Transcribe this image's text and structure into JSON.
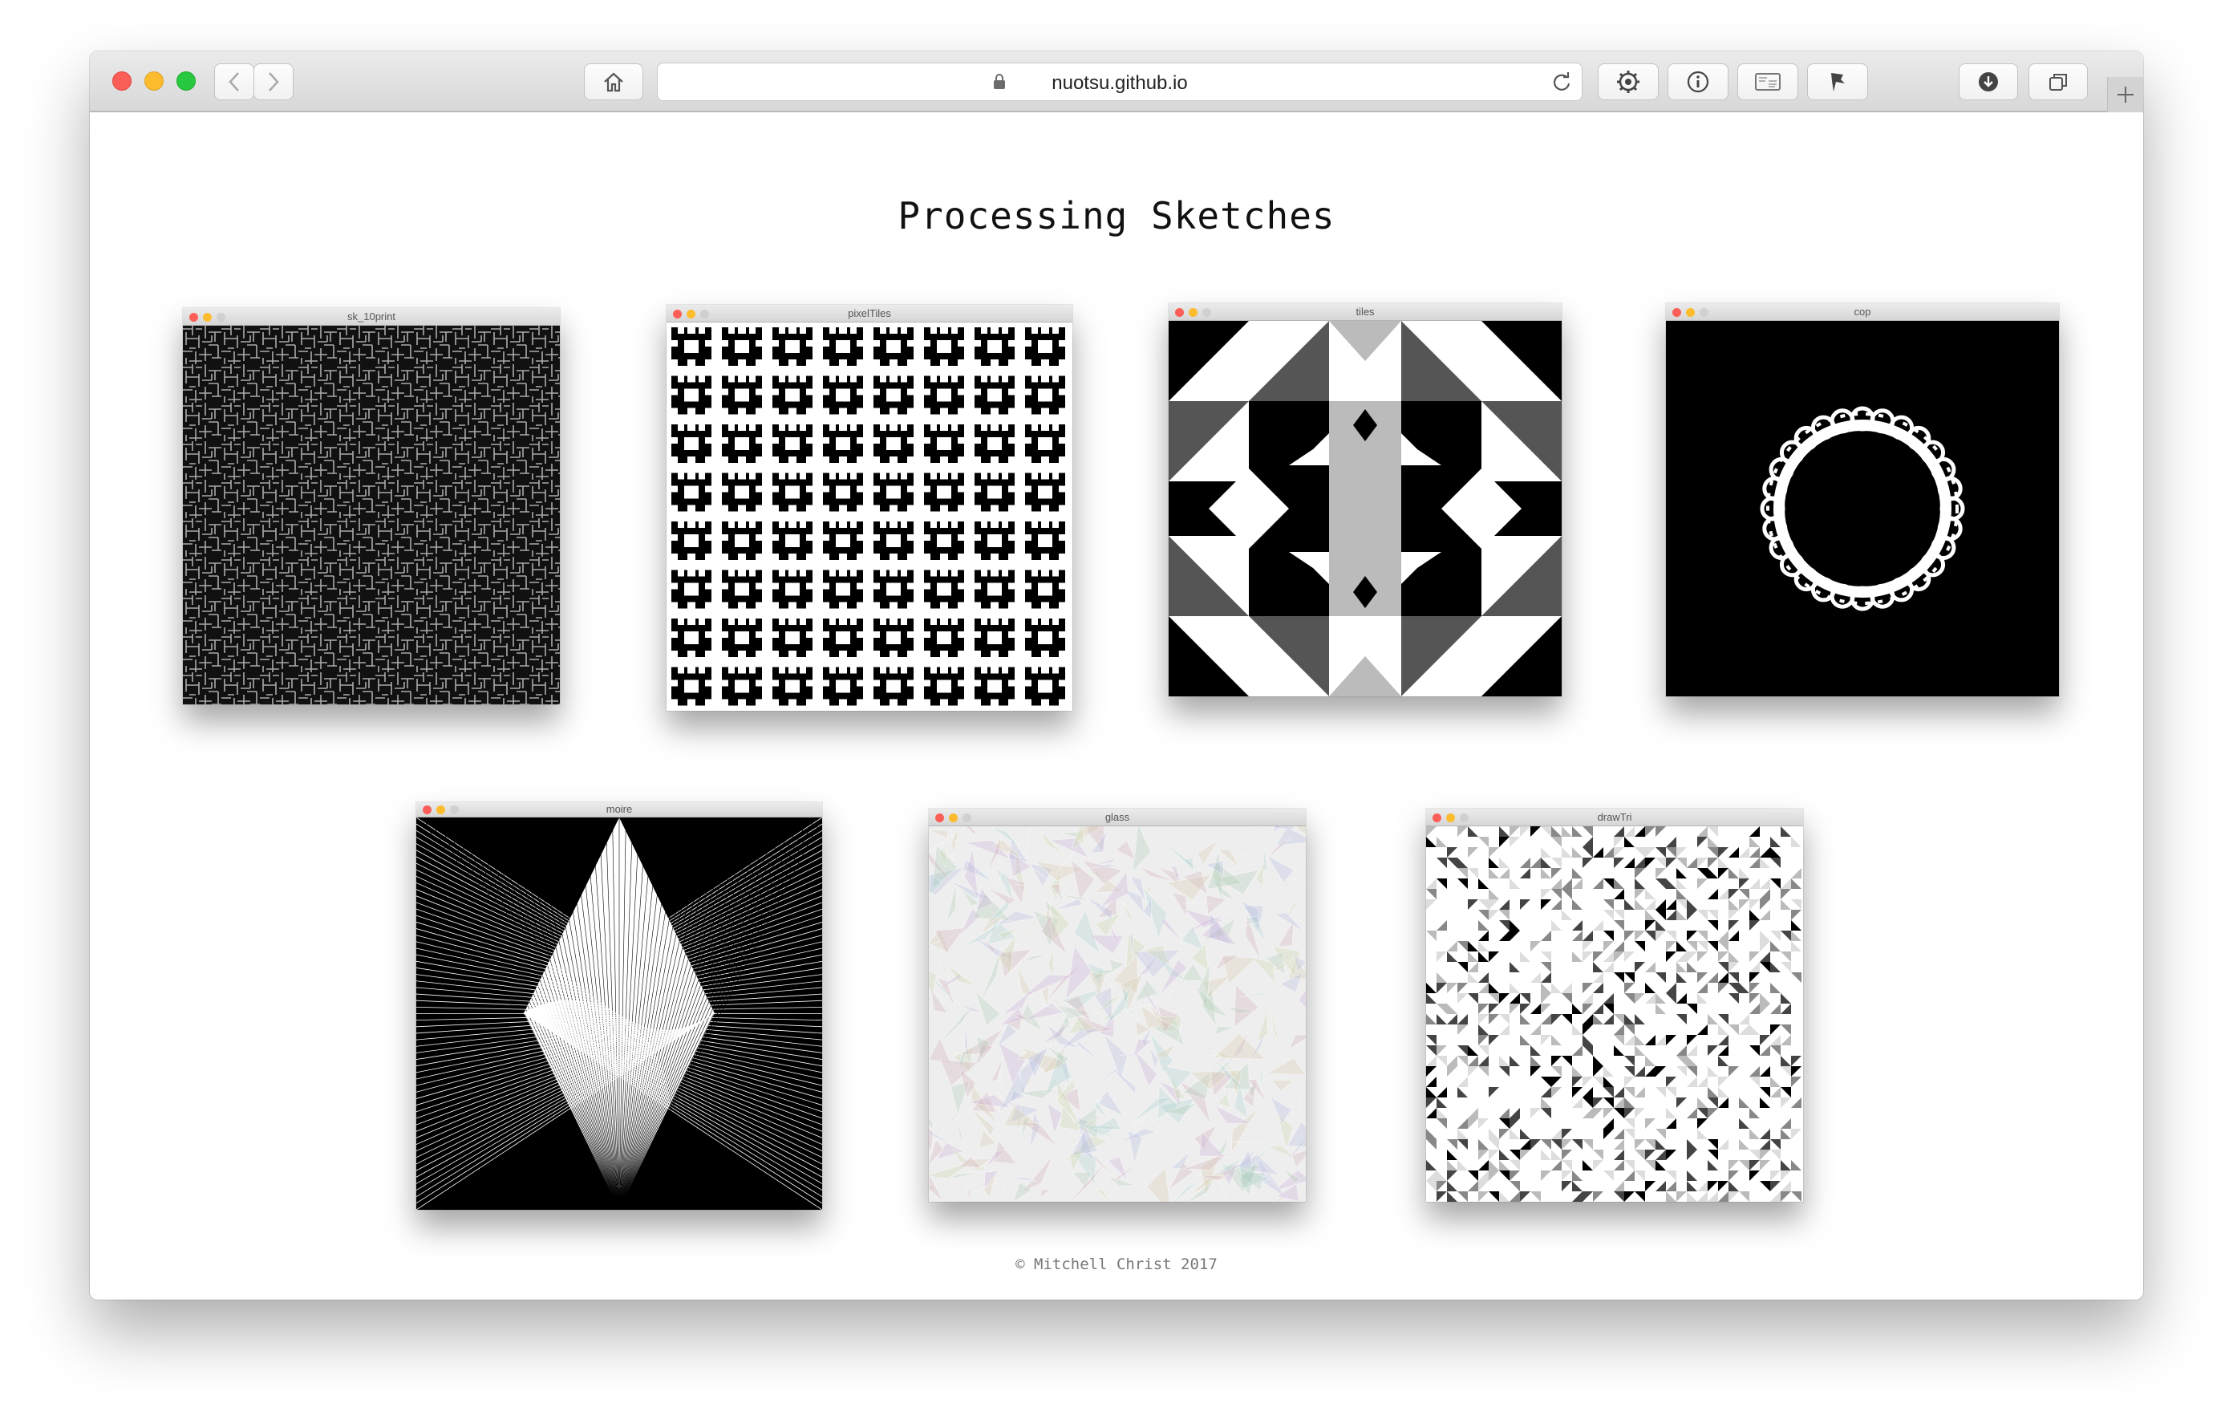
{
  "browser": {
    "url": "nuotsu.github.io",
    "icons": [
      "back-icon",
      "forward-icon",
      "home-icon",
      "lock-icon",
      "reload-icon",
      "gear-icon",
      "info-icon",
      "reader-icon",
      "pin-icon",
      "download-icon",
      "tabs-icon",
      "new-tab-icon"
    ]
  },
  "page": {
    "title": "Processing Sketches",
    "footer": "© Mitchell Christ 2017"
  },
  "sketches": [
    {
      "name": "sk_10print"
    },
    {
      "name": "pixelTiles"
    },
    {
      "name": "tiles"
    },
    {
      "name": "cop"
    },
    {
      "name": "moire"
    },
    {
      "name": "glass"
    },
    {
      "name": "drawTri"
    }
  ],
  "colors": {
    "close": "#fc5f57",
    "minimize": "#fdbc2e",
    "zoom": "#28c840",
    "inactive": "#d0d0d0"
  }
}
